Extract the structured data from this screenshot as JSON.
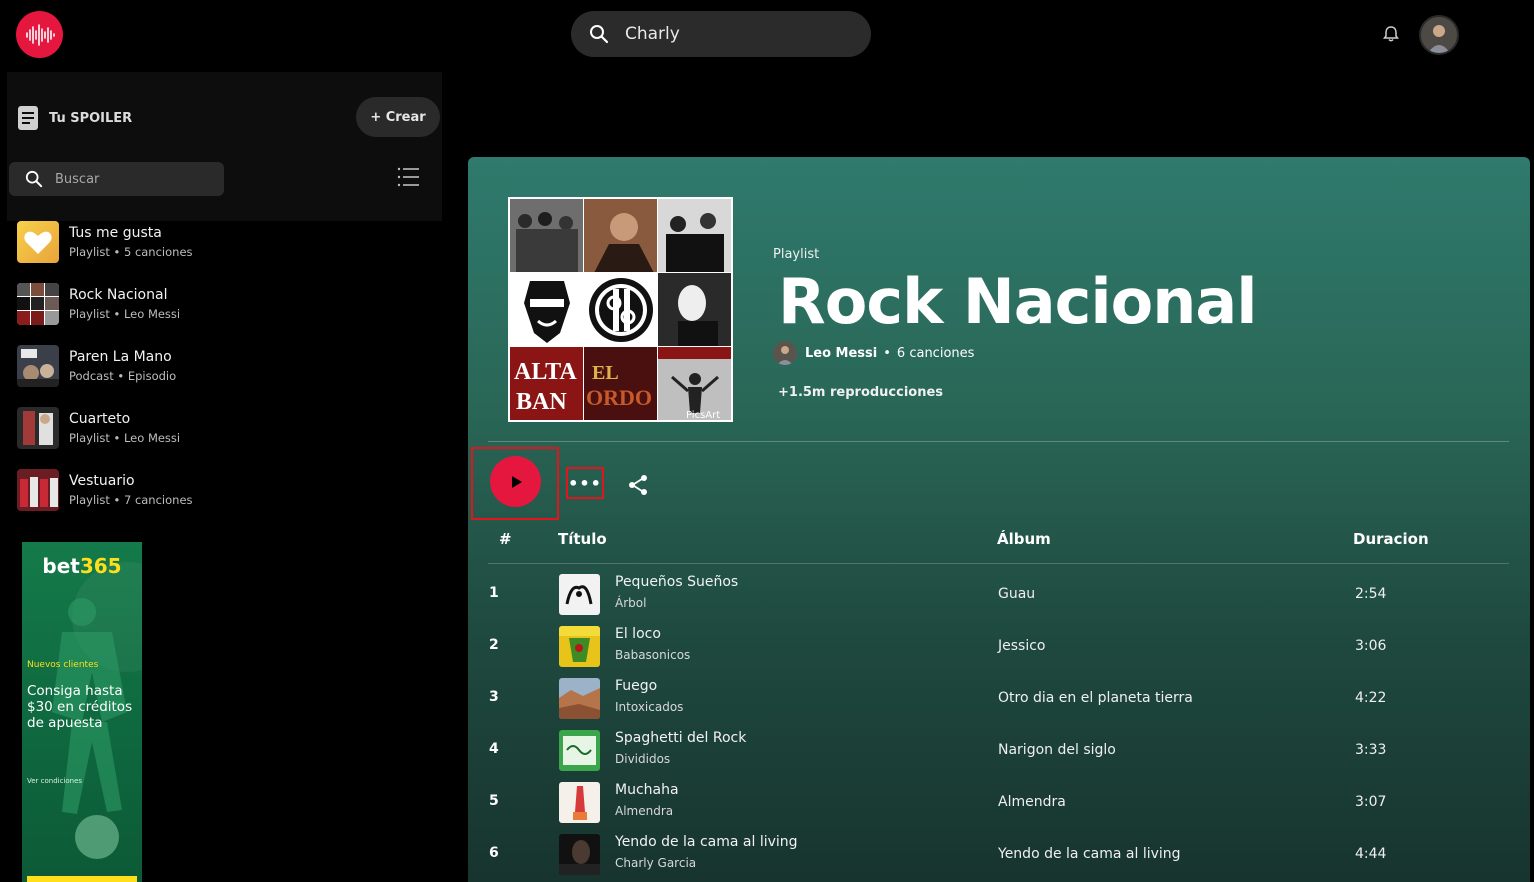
{
  "header": {
    "search_value": "Charly",
    "logo_icon": "soundwave-icon",
    "accent": "#e5173f"
  },
  "library": {
    "title": "Tu SPOILER",
    "create_label": "+ Crear",
    "search_placeholder": "Buscar",
    "items": [
      {
        "name": "Tus me gusta",
        "sub": "Playlist • 5 canciones"
      },
      {
        "name": "Rock Nacional",
        "sub": "Playlist • Leo Messi"
      },
      {
        "name": "Paren La Mano",
        "sub": "Podcast • Episodio"
      },
      {
        "name": "Cuarteto",
        "sub": "Playlist • Leo Messi"
      },
      {
        "name": "Vestuario",
        "sub": "Playlist • 7 canciones"
      }
    ]
  },
  "ad": {
    "brand_a": "bet",
    "brand_b": "365",
    "new_clients": "Nuevos clientes",
    "promo": "Consiga hasta $30 en créditos de apuesta",
    "conditions": "Ver condiciones"
  },
  "playlist": {
    "kind": "Playlist",
    "title": "Rock Nacional",
    "owner": "Leo Messi",
    "dot": "•",
    "count": "6 canciones",
    "plays": "+1.5m reproducciones",
    "more_label": "•••",
    "cover_watermark": "PicsArt",
    "columns": {
      "num": "#",
      "title": "Título",
      "album": "Álbum",
      "duration": "Duracion"
    },
    "tracks": [
      {
        "num": "1",
        "title": "Pequeños Sueños",
        "artist": "Árbol",
        "album": "Guau",
        "duration": "2:54"
      },
      {
        "num": "2",
        "title": "El loco",
        "artist": "Babasonicos",
        "album": "Jessico",
        "duration": "3:06"
      },
      {
        "num": "3",
        "title": "Fuego",
        "artist": "Intoxicados",
        "album": "Otro dia en el planeta tierra",
        "duration": "4:22"
      },
      {
        "num": "4",
        "title": "Spaghetti del Rock",
        "artist": "Divididos",
        "album": "Narigon del siglo",
        "duration": "3:33"
      },
      {
        "num": "5",
        "title": "Muchaha",
        "artist": "Almendra",
        "album": "Almendra",
        "duration": "3:07"
      },
      {
        "num": "6",
        "title": "Yendo de la cama al living",
        "artist": "Charly Garcia",
        "album": "Yendo de la cama al living",
        "duration": "4:44"
      }
    ]
  }
}
